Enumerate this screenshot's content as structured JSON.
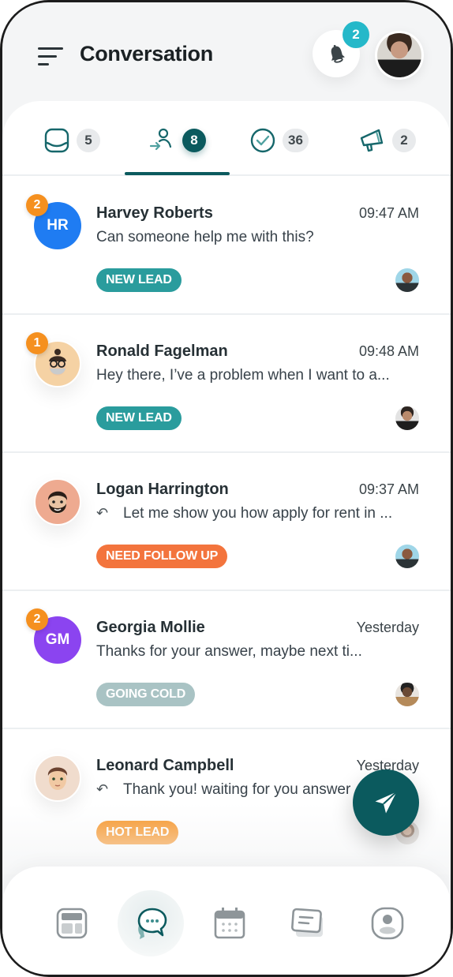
{
  "header": {
    "title": "Conversation",
    "notifications_count": "2"
  },
  "tabs": [
    {
      "id": "inbox",
      "icon": "inbox-icon",
      "count": "5",
      "active": false
    },
    {
      "id": "assigned",
      "icon": "user-assign-icon",
      "count": "8",
      "active": true
    },
    {
      "id": "resolved",
      "icon": "check-circle-icon",
      "count": "36",
      "active": false
    },
    {
      "id": "campaigns",
      "icon": "megaphone-icon",
      "count": "2",
      "active": false
    }
  ],
  "conversations": [
    {
      "name": "Harvey Roberts",
      "initials": "HR",
      "avatar_color": "#1f7cf2",
      "unread": "2",
      "time": "09:47 AM",
      "preview": "Can someone help me with this?",
      "replied": false,
      "tag": "NEW LEAD",
      "tag_color": "#2a9c9d"
    },
    {
      "name": "Ronald Fagelman",
      "initials": "",
      "avatar_color": "#f5d2a4",
      "unread": "1",
      "time": "09:48 AM",
      "preview": "Hey there, I’ve a problem when I want to a...",
      "replied": false,
      "tag": "NEW LEAD",
      "tag_color": "#2a9c9d"
    },
    {
      "name": "Logan Harrington",
      "initials": "",
      "avatar_color": "#eeaa90",
      "unread": "",
      "time": "09:37 AM",
      "preview": "Let me show you how apply for rent in ...",
      "replied": true,
      "tag": "NEED FOLLOW UP",
      "tag_color": "#f3743d"
    },
    {
      "name": "Georgia Mollie",
      "initials": "GM",
      "avatar_color": "#8b44f0",
      "unread": "2",
      "time": "Yesterday",
      "preview": "Thanks for your answer, maybe next ti...",
      "replied": false,
      "tag": "GOING COLD",
      "tag_color": "#a9c3c4"
    },
    {
      "name": "Leonard Campbell",
      "initials": "",
      "avatar_color": "#f0dccd",
      "unread": "",
      "time": "Yesterday",
      "preview": "Thank you! waiting for you answer",
      "replied": true,
      "tag": "HOT LEAD",
      "tag_color": "#f7901e"
    }
  ],
  "fab": {
    "icon": "send-icon"
  },
  "bottom_nav": [
    {
      "id": "dashboard",
      "icon": "dashboard-icon",
      "active": false
    },
    {
      "id": "conversations",
      "icon": "chat-icon",
      "active": true
    },
    {
      "id": "calendar",
      "icon": "calendar-icon",
      "active": false
    },
    {
      "id": "notes",
      "icon": "notes-icon",
      "active": false
    },
    {
      "id": "profile",
      "icon": "profile-icon",
      "active": false
    }
  ],
  "colors": {
    "primary": "#0b5a5e",
    "accent": "#25b8c9",
    "unread_badge": "#f5901f"
  }
}
